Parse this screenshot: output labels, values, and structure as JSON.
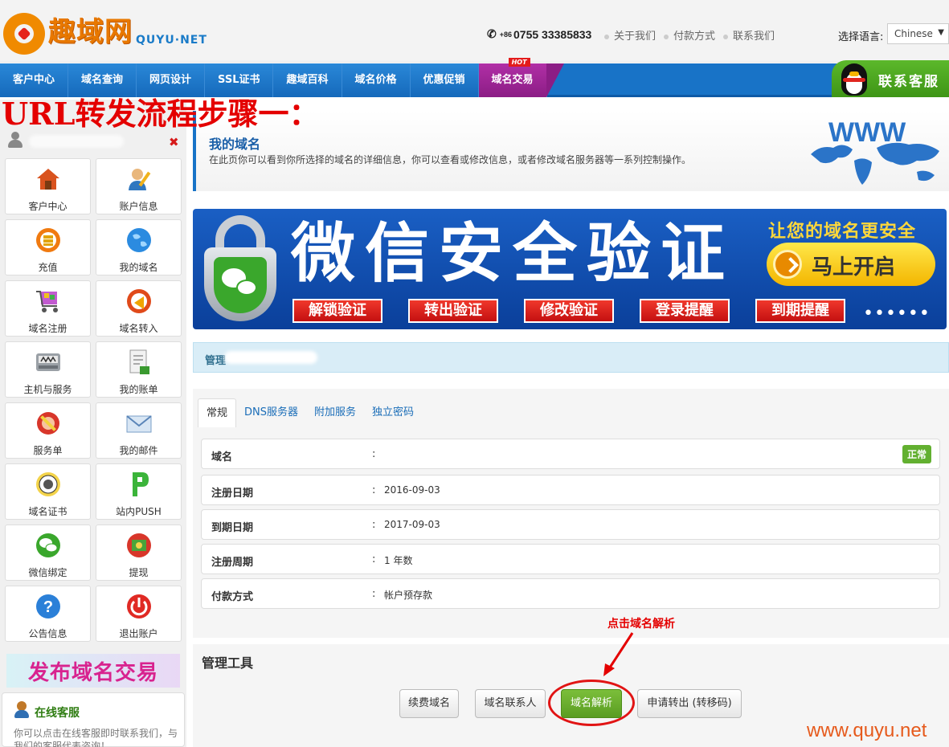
{
  "header": {
    "logo_cn": "趣域网",
    "logo_en": "QUYU·NET",
    "phone_cc": "+86",
    "phone": "0755 33385833",
    "links": [
      "关于我们",
      "付款方式",
      "联系我们"
    ],
    "lang_label": "选择语言:",
    "lang_value": "Chinese"
  },
  "nav": {
    "items": [
      "客户中心",
      "域名查询",
      "网页设计",
      "SSL证书",
      "趣域百科",
      "域名价格",
      "优惠促销",
      "域名交易"
    ],
    "hot_badge": "HOT",
    "service_label": "联系客服"
  },
  "annotation": {
    "title": "URL转发流程步骤一：",
    "tip": "点击域名解析"
  },
  "sidebar": {
    "tiles": [
      {
        "label": "客户中心",
        "icon": "house-icon"
      },
      {
        "label": "账户信息",
        "icon": "user-edit-icon"
      },
      {
        "label": "充值",
        "icon": "coins-icon"
      },
      {
        "label": "我的域名",
        "icon": "globe-icon"
      },
      {
        "label": "域名注册",
        "icon": "cart-icon"
      },
      {
        "label": "域名转入",
        "icon": "transfer-icon"
      },
      {
        "label": "主机与服务",
        "icon": "server-icon"
      },
      {
        "label": "我的账单",
        "icon": "bill-icon"
      },
      {
        "label": "服务单",
        "icon": "ticket-icon"
      },
      {
        "label": "我的邮件",
        "icon": "mail-icon"
      },
      {
        "label": "域名证书",
        "icon": "certificate-icon"
      },
      {
        "label": "站内PUSH",
        "icon": "push-icon"
      },
      {
        "label": "微信绑定",
        "icon": "wechat-icon"
      },
      {
        "label": "提现",
        "icon": "withdraw-icon"
      },
      {
        "label": "公告信息",
        "icon": "help-icon"
      },
      {
        "label": "退出账户",
        "icon": "power-icon"
      }
    ],
    "promo": "发布域名交易",
    "online_title": "在线客服",
    "online_text": "你可以点击在线客服即时联系我们，与我们的客服代表咨询！"
  },
  "page": {
    "title": "我的域名",
    "desc": "在此页你可以看到你所选择的域名的详细信息，你可以查看或修改信息，或者修改域名服务器等一系列控制操作。",
    "www_text": "WWW"
  },
  "banner": {
    "title": "微信安全验证",
    "sub": "让您的域名更安全",
    "cta": "马上开启",
    "tags": [
      "解锁验证",
      "转出验证",
      "修改验证",
      "登录提醒",
      "到期提醒"
    ],
    "dots": "••••••"
  },
  "manage": {
    "label": "管理"
  },
  "tabs": [
    "常规",
    "DNS服务器",
    "附加服务",
    "独立密码"
  ],
  "details": [
    {
      "key": "域名",
      "value": "",
      "badge": "正常"
    },
    {
      "key": "注册日期",
      "value": "2016-09-03"
    },
    {
      "key": "到期日期",
      "value": "2017-09-03"
    },
    {
      "key": "注册周期",
      "value": "1 年数"
    },
    {
      "key": "付款方式",
      "value": "帐户预存款"
    }
  ],
  "colon": ":",
  "tools": {
    "title": "管理工具",
    "buttons": [
      "续费域名",
      "域名联系人",
      "域名解析",
      "申请转出 (转移码)"
    ]
  },
  "watermark": "www.quyu.net",
  "colors": {
    "nav_blue": "#1873c7",
    "trade_purple": "#a8289f",
    "accent_green": "#62b030",
    "annotation_red": "#e40000"
  }
}
